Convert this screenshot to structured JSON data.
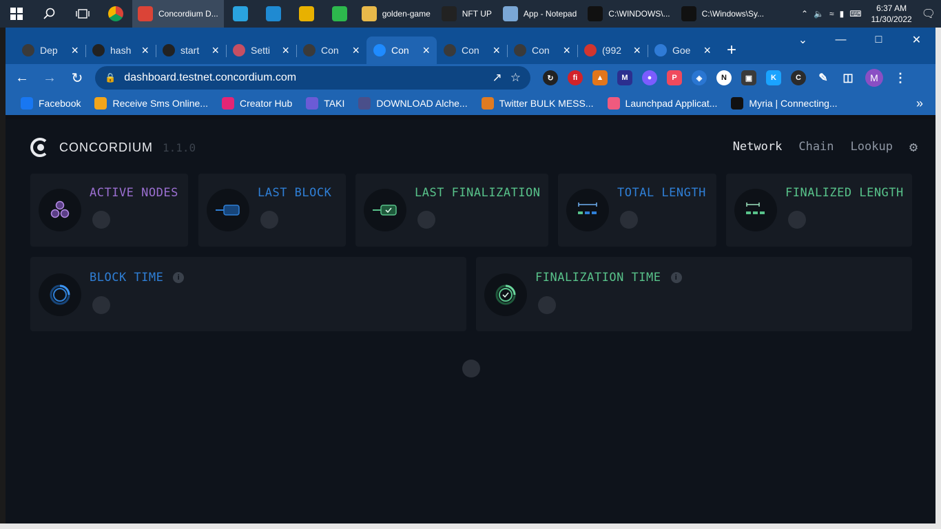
{
  "taskbar": {
    "apps": [
      {
        "label": "Concordium D...",
        "icon": "chrome-profile-icon",
        "color": "#db4437"
      },
      {
        "label": "",
        "icon": "telegram-icon",
        "color": "#2aa3df"
      },
      {
        "label": "",
        "icon": "vscode-icon",
        "color": "#1f8ad2"
      },
      {
        "label": "",
        "icon": "chrome-icon",
        "color": "#e8b100"
      },
      {
        "label": "",
        "icon": "evernote-green-icon",
        "color": "#2db84d"
      },
      {
        "label": "golden-game",
        "icon": "folder-icon",
        "color": "#e8b94a"
      },
      {
        "label": "NFT UP",
        "icon": "nftup-icon",
        "color": "#222222"
      },
      {
        "label": "App - Notepad",
        "icon": "notepad-icon",
        "color": "#7aa7d6"
      },
      {
        "label": "C:\\WINDOWS\\...",
        "icon": "cmd-icon",
        "color": "#111111"
      },
      {
        "label": "C:\\Windows\\Sy...",
        "icon": "cmd-icon",
        "color": "#111111"
      }
    ],
    "time": "6:37 AM",
    "date": "11/30/2022"
  },
  "browser": {
    "tabs": [
      {
        "title": "Dep",
        "icon": "concordium-icon",
        "color": "#3a3a3a"
      },
      {
        "title": "hash",
        "icon": "github-icon",
        "color": "#222222"
      },
      {
        "title": "start",
        "icon": "github-icon",
        "color": "#222222"
      },
      {
        "title": "Setti",
        "icon": "settings-wave-icon",
        "color": "#c64f63"
      },
      {
        "title": "Con",
        "icon": "concordium-icon",
        "color": "#3a3a3a"
      },
      {
        "title": "Con",
        "icon": "concordium-icon",
        "color": "#1f8bff",
        "active": true
      },
      {
        "title": "Con",
        "icon": "concordium-icon",
        "color": "#3a3a3a"
      },
      {
        "title": "Con",
        "icon": "concordium-icon",
        "color": "#3a3a3a"
      },
      {
        "title": "(992",
        "icon": "notification-992-icon",
        "color": "#d2352f"
      },
      {
        "title": "Goe",
        "icon": "goerli-icon",
        "color": "#2f7bd6"
      }
    ],
    "url": "dashboard.testnet.concordium.com",
    "profile_initial": "M",
    "bookmarks": [
      {
        "label": "Facebook",
        "icon": "facebook-icon",
        "color": "#1877f2"
      },
      {
        "label": "Receive Sms Online...",
        "icon": "sms-icon",
        "color": "#f2a51a"
      },
      {
        "label": "Creator Hub",
        "icon": "magiceden-icon",
        "color": "#e42575"
      },
      {
        "label": "TAKI",
        "icon": "taki-icon",
        "color": "#6b5bd6"
      },
      {
        "label": "DOWNLOAD Alche...",
        "icon": "alchemy-icon",
        "color": "#4a4f8a"
      },
      {
        "label": "Twitter BULK MESS...",
        "icon": "twitter-bulk-icon",
        "color": "#e07b22"
      },
      {
        "label": "Launchpad Applicat...",
        "icon": "launchpad-icon",
        "color": "#f05a7e"
      },
      {
        "label": "Myria | Connecting...",
        "icon": "myria-icon",
        "color": "#111111"
      }
    ]
  },
  "page": {
    "brand": "CONCORDIUM",
    "version": "1.1.0",
    "nav": [
      "Network",
      "Chain",
      "Lookup"
    ],
    "cards_row1": [
      {
        "title": "ACTIVE NODES",
        "color": "#9b6fd1",
        "icon": "nodes-icon"
      },
      {
        "title": "LAST BLOCK",
        "color": "#2f7fd6",
        "icon": "block-icon"
      },
      {
        "title": "LAST FINALIZATION",
        "color": "#58c28a",
        "icon": "finalized-block-icon"
      },
      {
        "title": "TOTAL LENGTH",
        "color": "#2f7fd6",
        "icon": "chain-length-icon"
      },
      {
        "title": "FINALIZED LENGTH",
        "color": "#58c28a",
        "icon": "finalized-length-icon"
      }
    ],
    "cards_row2": [
      {
        "title": "BLOCK TIME",
        "color": "#2f7fd6",
        "icon": "block-time-icon"
      },
      {
        "title": "FINALIZATION TIME",
        "color": "#58c28a",
        "icon": "finalization-time-icon"
      }
    ]
  }
}
